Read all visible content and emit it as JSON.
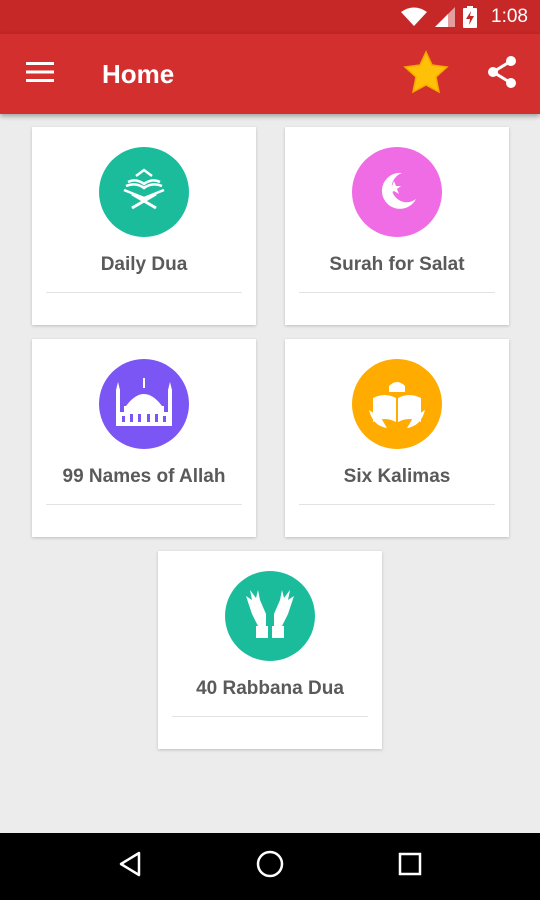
{
  "status_bar": {
    "time": "1:08",
    "icons": [
      "wifi-icon",
      "signal-icon",
      "battery-charging-icon"
    ]
  },
  "app_bar": {
    "title": "Home",
    "icons": [
      "menu-icon",
      "star-icon",
      "share-icon"
    ]
  },
  "cards": [
    {
      "label": "Daily Dua",
      "icon": "quran-stand-icon",
      "color": "#1bbc9b"
    },
    {
      "label": "Surah for Salat",
      "icon": "crescent-star-icon",
      "color": "#ef6ce5"
    },
    {
      "label": "99 Names of Allah",
      "icon": "mosque-icon",
      "color": "#7c55f5"
    },
    {
      "label": "Six Kalimas",
      "icon": "open-book-icon",
      "color": "#ffab00"
    },
    {
      "label": "40 Rabbana Dua",
      "icon": "praying-hands-icon",
      "color": "#1bbc9b"
    }
  ],
  "nav_bar": {
    "icons": [
      "back-icon",
      "home-icon",
      "recents-icon"
    ]
  },
  "colors": {
    "status_bar": "#c62828",
    "app_bar": "#d32f2f",
    "background": "#ececec",
    "star": "#ffc107"
  }
}
